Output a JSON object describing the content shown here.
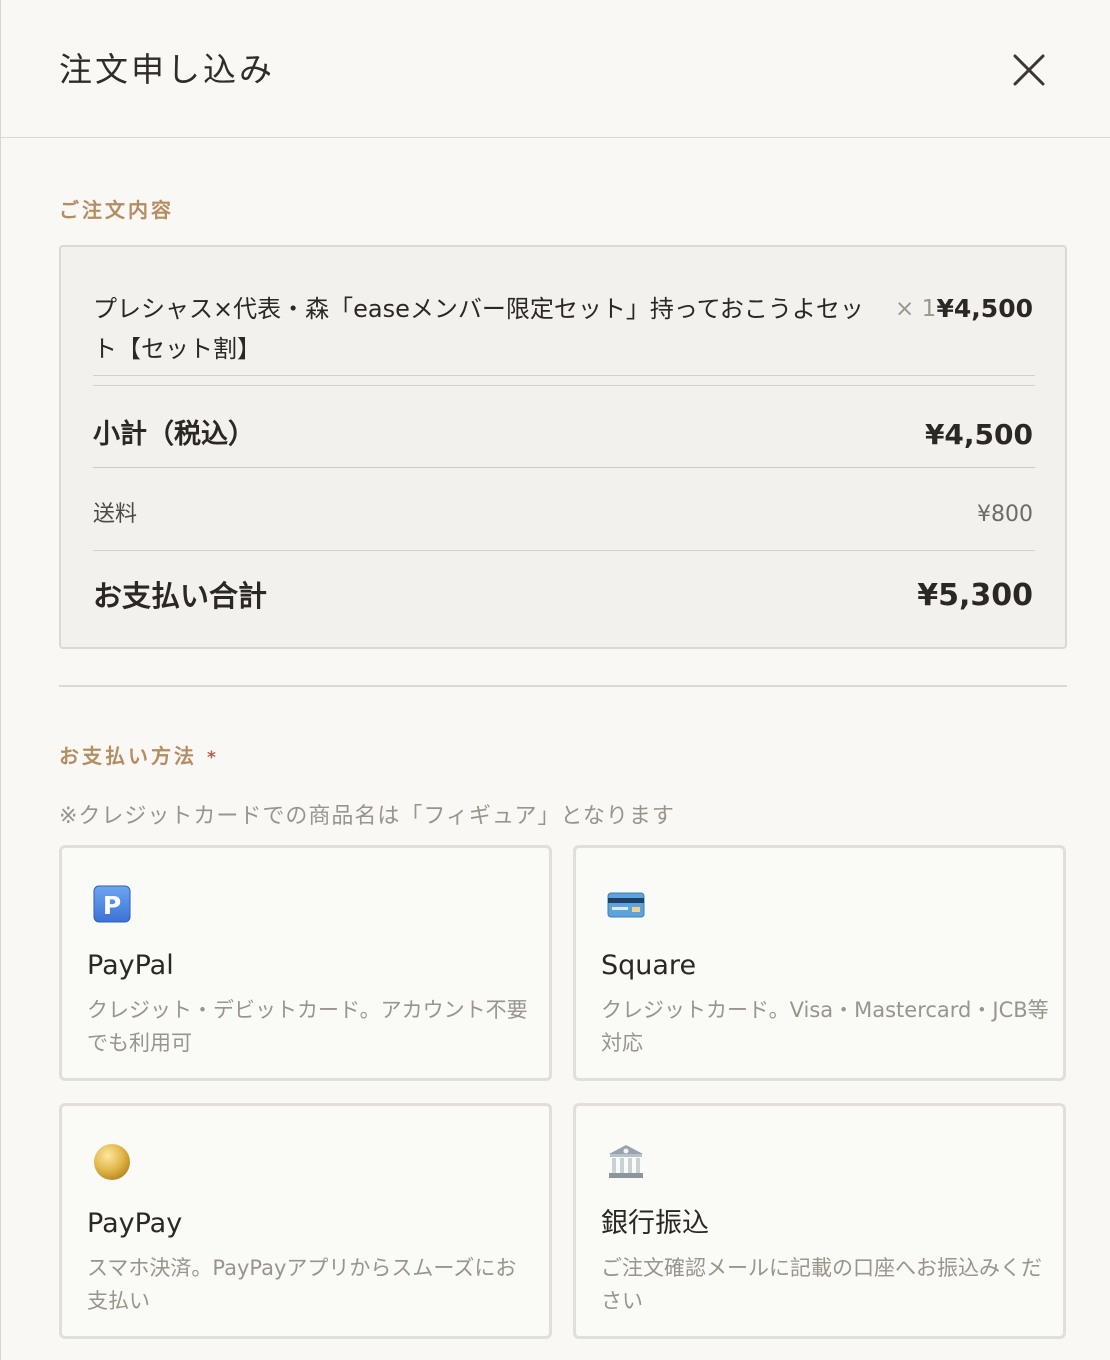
{
  "header": {
    "title": "注文申し込み",
    "close_icon": "close-icon"
  },
  "order": {
    "section_label": "ご注文内容",
    "item": {
      "name": "プレシャス×代表・森「easeメンバー限定セット」持っておこうよセット【セット割】",
      "qty": "× 1",
      "price": "¥4,500"
    },
    "subtotal": {
      "label": "小計（税込）",
      "value": "¥4,500"
    },
    "shipping": {
      "label": "送料",
      "value": "¥800"
    },
    "total": {
      "label": "お支払い合計",
      "value": "¥5,300"
    }
  },
  "payment": {
    "section_label": "お支払い方法",
    "required_mark": "*",
    "note": "※クレジットカードでの商品名は「フィギュア」となります",
    "methods": [
      {
        "name": "PayPal",
        "desc": "クレジット・デビットカード。アカウント不要でも利用可",
        "icon": "paypal-p-icon"
      },
      {
        "name": "Square",
        "desc": "クレジットカード。Visa・Mastercard・JCB等対応",
        "icon": "credit-card-icon"
      },
      {
        "name": "PayPay",
        "desc": "スマホ決済。PayPayアプリからスムーズにお支払い",
        "icon": "coin-icon"
      },
      {
        "name": "銀行振込",
        "desc": "ご注文確認メールに記載の口座へお振込みください",
        "icon": "bank-icon"
      }
    ]
  },
  "colors": {
    "accent": "#b48e62",
    "background": "#f9f8f5",
    "summary_bg": "#f3f1ed",
    "border": "#dcd9d3"
  }
}
